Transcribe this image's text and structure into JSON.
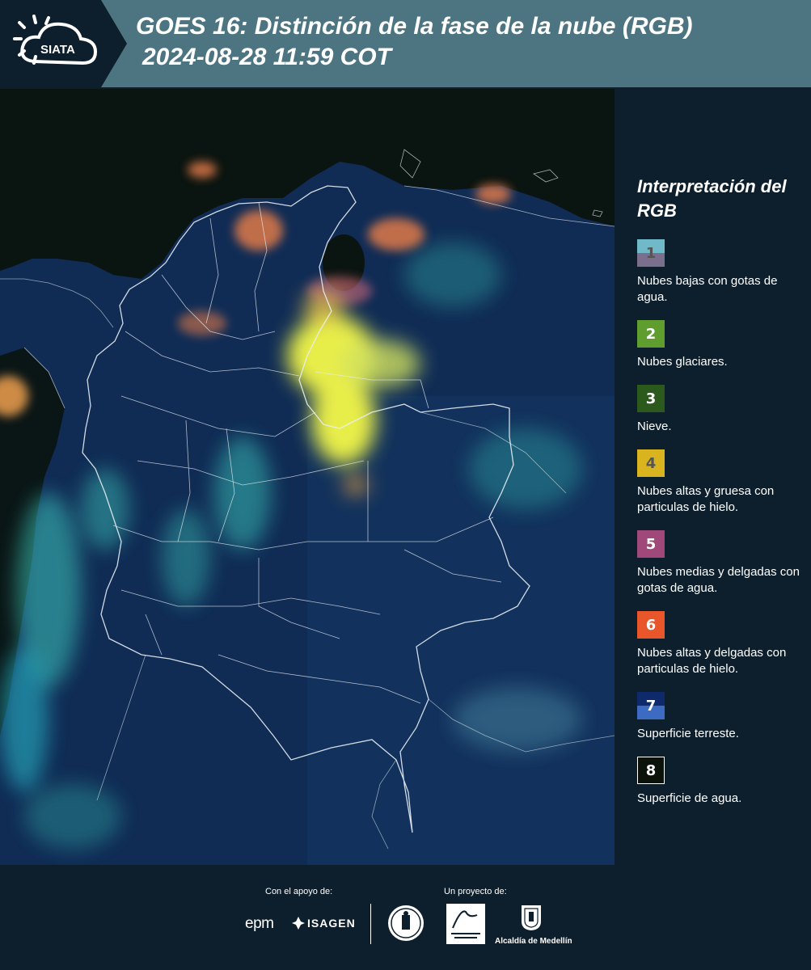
{
  "header": {
    "brand": "SIATA",
    "title_line1": "GOES 16: Distinción de la fase de la nube (RGB)",
    "title_line2": "2024-08-28 11:59 COT"
  },
  "legend": {
    "title": "Interpretación del RGB",
    "items": [
      {
        "number": "1",
        "label": "Nubes bajas con gotas de agua.",
        "colors": [
          "#6fb9c8",
          "#7a6f8c"
        ],
        "text_color": "#555555"
      },
      {
        "number": "2",
        "label": "Nubes glaciares.",
        "colors": [
          "#5f9e2e"
        ],
        "text_color": "#ffffff"
      },
      {
        "number": "3",
        "label": "Nieve.",
        "colors": [
          "#2c5a1c"
        ],
        "text_color": "#ffffff"
      },
      {
        "number": "4",
        "label": "Nubes altas y gruesa con particulas de hielo.",
        "colors": [
          "#d9b41e"
        ],
        "text_color": "#555555"
      },
      {
        "number": "5",
        "label": "Nubes medias y delgadas con gotas de agua.",
        "colors": [
          "#a0487a"
        ],
        "text_color": "#ffffff"
      },
      {
        "number": "6",
        "label": "Nubes altas y delgadas con particulas de hielo.",
        "colors": [
          "#e8562a"
        ],
        "text_color": "#ffffff"
      },
      {
        "number": "7",
        "label": "Superficie terreste.",
        "colors": [
          "#0f2a6b",
          "#3d6bc2"
        ],
        "text_color": "#ffffff"
      },
      {
        "number": "8",
        "label": "Superficie de agua.",
        "colors": [
          "#0a120a"
        ],
        "text_color": "#ffffff"
      }
    ]
  },
  "footer": {
    "support_label": "Con el apoyo de:",
    "project_label": "Un proyecto de:",
    "sponsor_1": "epm",
    "sponsor_2": "ISAGEN",
    "partner_label": "Alcaldía de Medellín"
  },
  "colors": {
    "header_band": "#4d7581",
    "background": "#0d1f2c",
    "land": "#102c55",
    "ocean": "#0a1410",
    "thick_ice_cloud": "#e8ee4a",
    "thin_ice_cloud": "#e07a48",
    "low_water_cloud": "#3fd4c4"
  }
}
